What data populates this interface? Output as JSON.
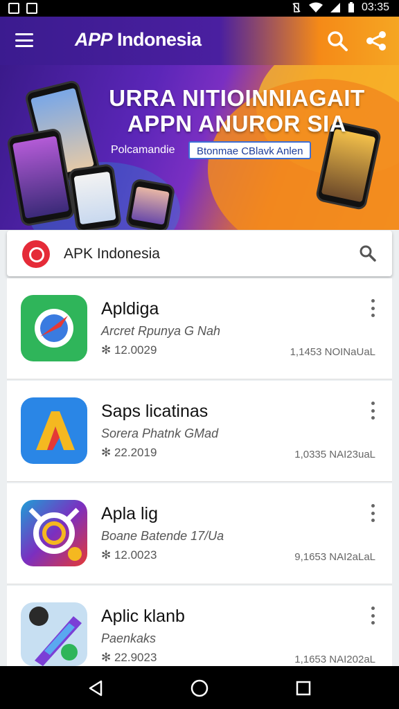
{
  "status_bar": {
    "time": "03:35"
  },
  "app_bar": {
    "title_prefix": "APP",
    "title_rest": " Indonesia"
  },
  "banner": {
    "headline_line1": "URRA NITIOINNIAGAIT",
    "headline_line2": "APPN ANUROR SIA",
    "subtitle": "Polcamandie",
    "pill_text": "Btonmae CBlavk Anlen"
  },
  "search": {
    "text": "APK Indonesia"
  },
  "apps": [
    {
      "name": "Apldiga",
      "developer": "Arcret Rpunya G Nah",
      "version": "12.0029",
      "size": "1,1453 NOINaUaL"
    },
    {
      "name": "Saps licatinas",
      "developer": "Sorera Phatnk GMad",
      "version": "22.2019",
      "size": "1,0335 NAI23uaL"
    },
    {
      "name": "Apla lig",
      "developer": "Boane Batende 17/Ua",
      "version": "12.0023",
      "size": "9,1653 NAI2aLaL"
    },
    {
      "name": "Aplic klanb",
      "developer": "Paenkaks",
      "version": "22.9023",
      "size": "1,1653 NAI202aL"
    }
  ],
  "colors": {
    "accent_purple": "#4a1fa0",
    "accent_orange": "#f5a623",
    "logo_red": "#e52b38"
  }
}
